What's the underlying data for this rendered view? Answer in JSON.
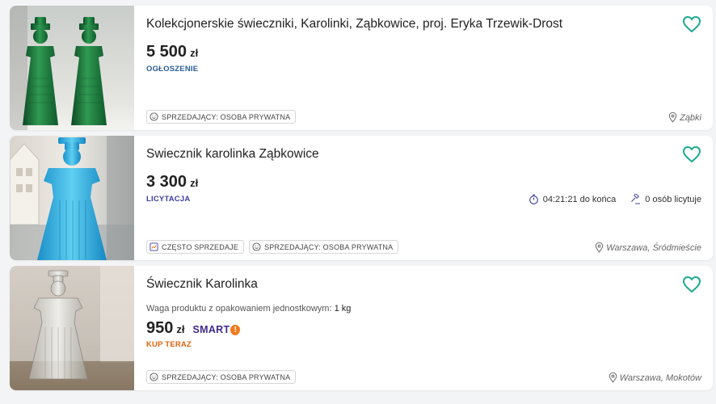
{
  "listings": [
    {
      "title": "Kolekcjonerskie świeczniki, Karolinki, Ząbkowice, proj. Eryka Trzewik-Drost",
      "price": "5 500",
      "currency": "zł",
      "type_label": "OGŁOSZENIE",
      "badges": [
        "SPRZEDAJĄCY: OSOBA PRYWATNA"
      ],
      "location": "Ząbki",
      "image_desc": "two green glass candlesticks"
    },
    {
      "title": "Swiecznik karolinka Ząbkowice",
      "price": "3 300",
      "currency": "zł",
      "type_label": "LICYTACJA",
      "time_left": "04:21:21 do końca",
      "bidders": "0 osób licytuje",
      "badges": [
        "CZĘSTO SPRZEDAJE",
        "SPRZEDAJĄCY: OSOBA PRYWATNA"
      ],
      "location": "Warszawa, Śródmieście",
      "image_desc": "blue glass candlestick"
    },
    {
      "title": "Świecznik Karolinka",
      "weight_label": "Waga produktu z opakowaniem jednostkowym:",
      "weight_value": "1 kg",
      "price": "950",
      "currency": "zł",
      "smart_label": "SMART",
      "smart_mark": "!",
      "type_label": "KUP TERAZ",
      "badges": [
        "SPRZEDAJĄCY: OSOBA PRYWATNA"
      ],
      "location": "Warszawa, Mokotów",
      "image_desc": "clear glass candlestick"
    }
  ],
  "icons": {
    "favorite": "heart-outline-icon",
    "seller": "smiley-icon",
    "frequent": "chart-box-icon",
    "location": "map-pin-icon",
    "timer": "stopwatch-icon",
    "bids": "gavel-icon"
  },
  "colors": {
    "accent": "#1ca891",
    "ad_label": "#2b5c9a",
    "auction_label": "#3d3e9c",
    "buy_now": "#e0630c",
    "smart": "#3f2a8c"
  }
}
